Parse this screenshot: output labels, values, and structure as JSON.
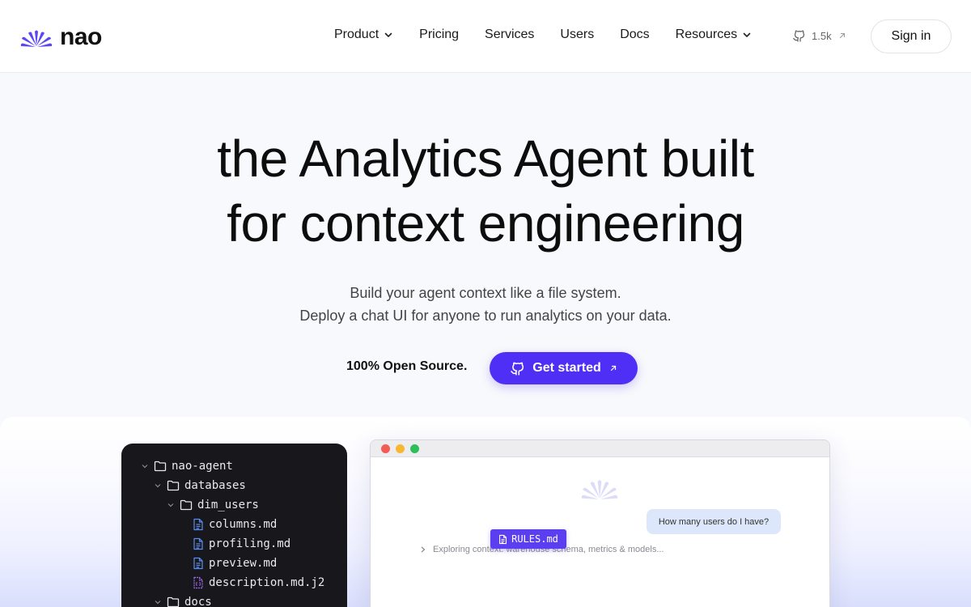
{
  "brand": {
    "name": "nao",
    "accent": "#4f2ff5"
  },
  "nav": {
    "items": [
      {
        "label": "Product",
        "dropdown": true
      },
      {
        "label": "Pricing",
        "dropdown": false
      },
      {
        "label": "Services",
        "dropdown": false
      },
      {
        "label": "Users",
        "dropdown": false
      },
      {
        "label": "Docs",
        "dropdown": false
      },
      {
        "label": "Resources",
        "dropdown": true
      }
    ],
    "github_stars": "1.5k",
    "signin_label": "Sign in"
  },
  "hero": {
    "title_line1": "the Analytics Agent built",
    "title_line2": "for context engineering",
    "sub_line1": "Build your agent context like a file system.",
    "sub_line2": "Deploy a chat UI for anyone to run analytics on your data.",
    "oss_label": "100% Open Source.",
    "cta_label": "Get started"
  },
  "file_tree": [
    {
      "name": "nao-agent",
      "type": "folder",
      "depth": 0,
      "expanded": true
    },
    {
      "name": "databases",
      "type": "folder",
      "depth": 1,
      "expanded": true
    },
    {
      "name": "dim_users",
      "type": "folder",
      "depth": 2,
      "expanded": true
    },
    {
      "name": "columns.md",
      "type": "file",
      "depth": 3
    },
    {
      "name": "profiling.md",
      "type": "file",
      "depth": 3
    },
    {
      "name": "preview.md",
      "type": "file",
      "depth": 3
    },
    {
      "name": "description.md.j2",
      "type": "template",
      "depth": 3
    },
    {
      "name": "docs",
      "type": "folder",
      "depth": 1,
      "expanded": true
    }
  ],
  "chat": {
    "user_message": "How many users do I have?",
    "status_text": "Exploring context: warehouse schema, metrics & models...",
    "dragged_file": "RULES.md"
  }
}
